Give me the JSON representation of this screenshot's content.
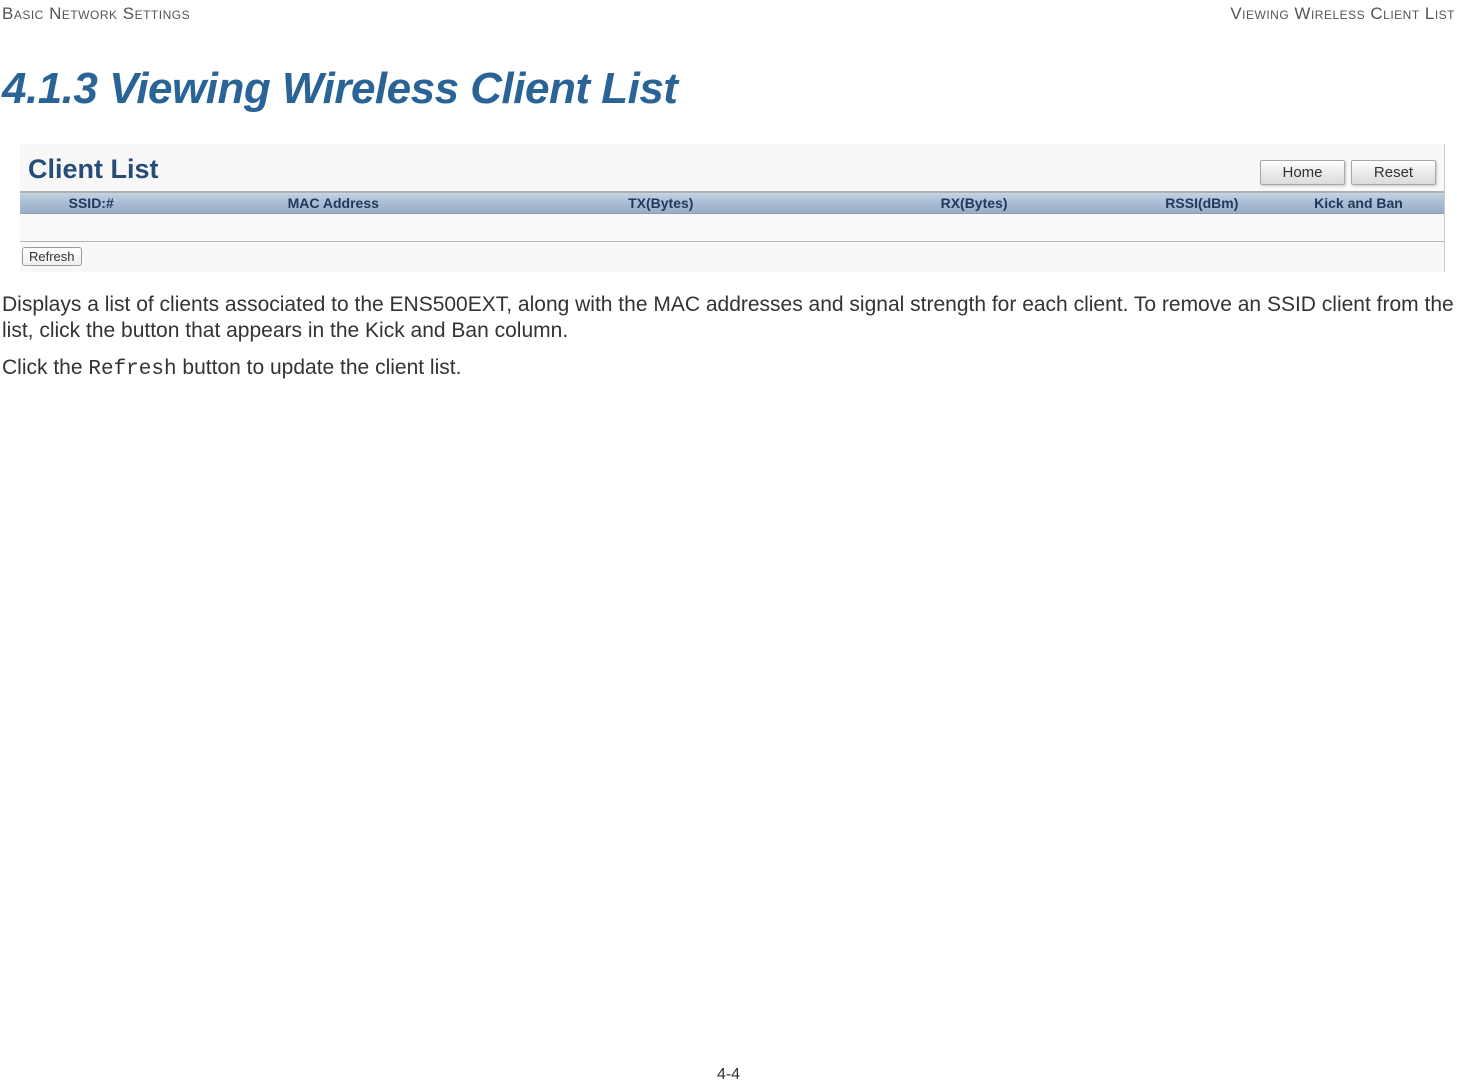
{
  "header": {
    "left": "Basic Network Settings",
    "right": "Viewing Wireless Client List"
  },
  "section": {
    "number": "4.1.3",
    "title": "Viewing Wireless Client List"
  },
  "screenshot": {
    "panel_title": "Client List",
    "buttons": {
      "home": "Home",
      "reset": "Reset"
    },
    "columns": {
      "ssid": "SSID:#",
      "mac": "MAC Address",
      "tx": "TX(Bytes)",
      "rx": "RX(Bytes)",
      "rssi": "RSSI(dBm)",
      "kick": "Kick and Ban"
    },
    "refresh": "Refresh"
  },
  "description": {
    "p1": "Displays a list of clients associated to the ENS500EXT, along with the MAC addresses and signal strength for each client. To remove an SSID client from the list, click the button that appears in the Kick and Ban column.",
    "p2_pre": "Click the ",
    "p2_code": "Refresh",
    "p2_post": " button to update the client list."
  },
  "footer": {
    "page": "4-4"
  }
}
